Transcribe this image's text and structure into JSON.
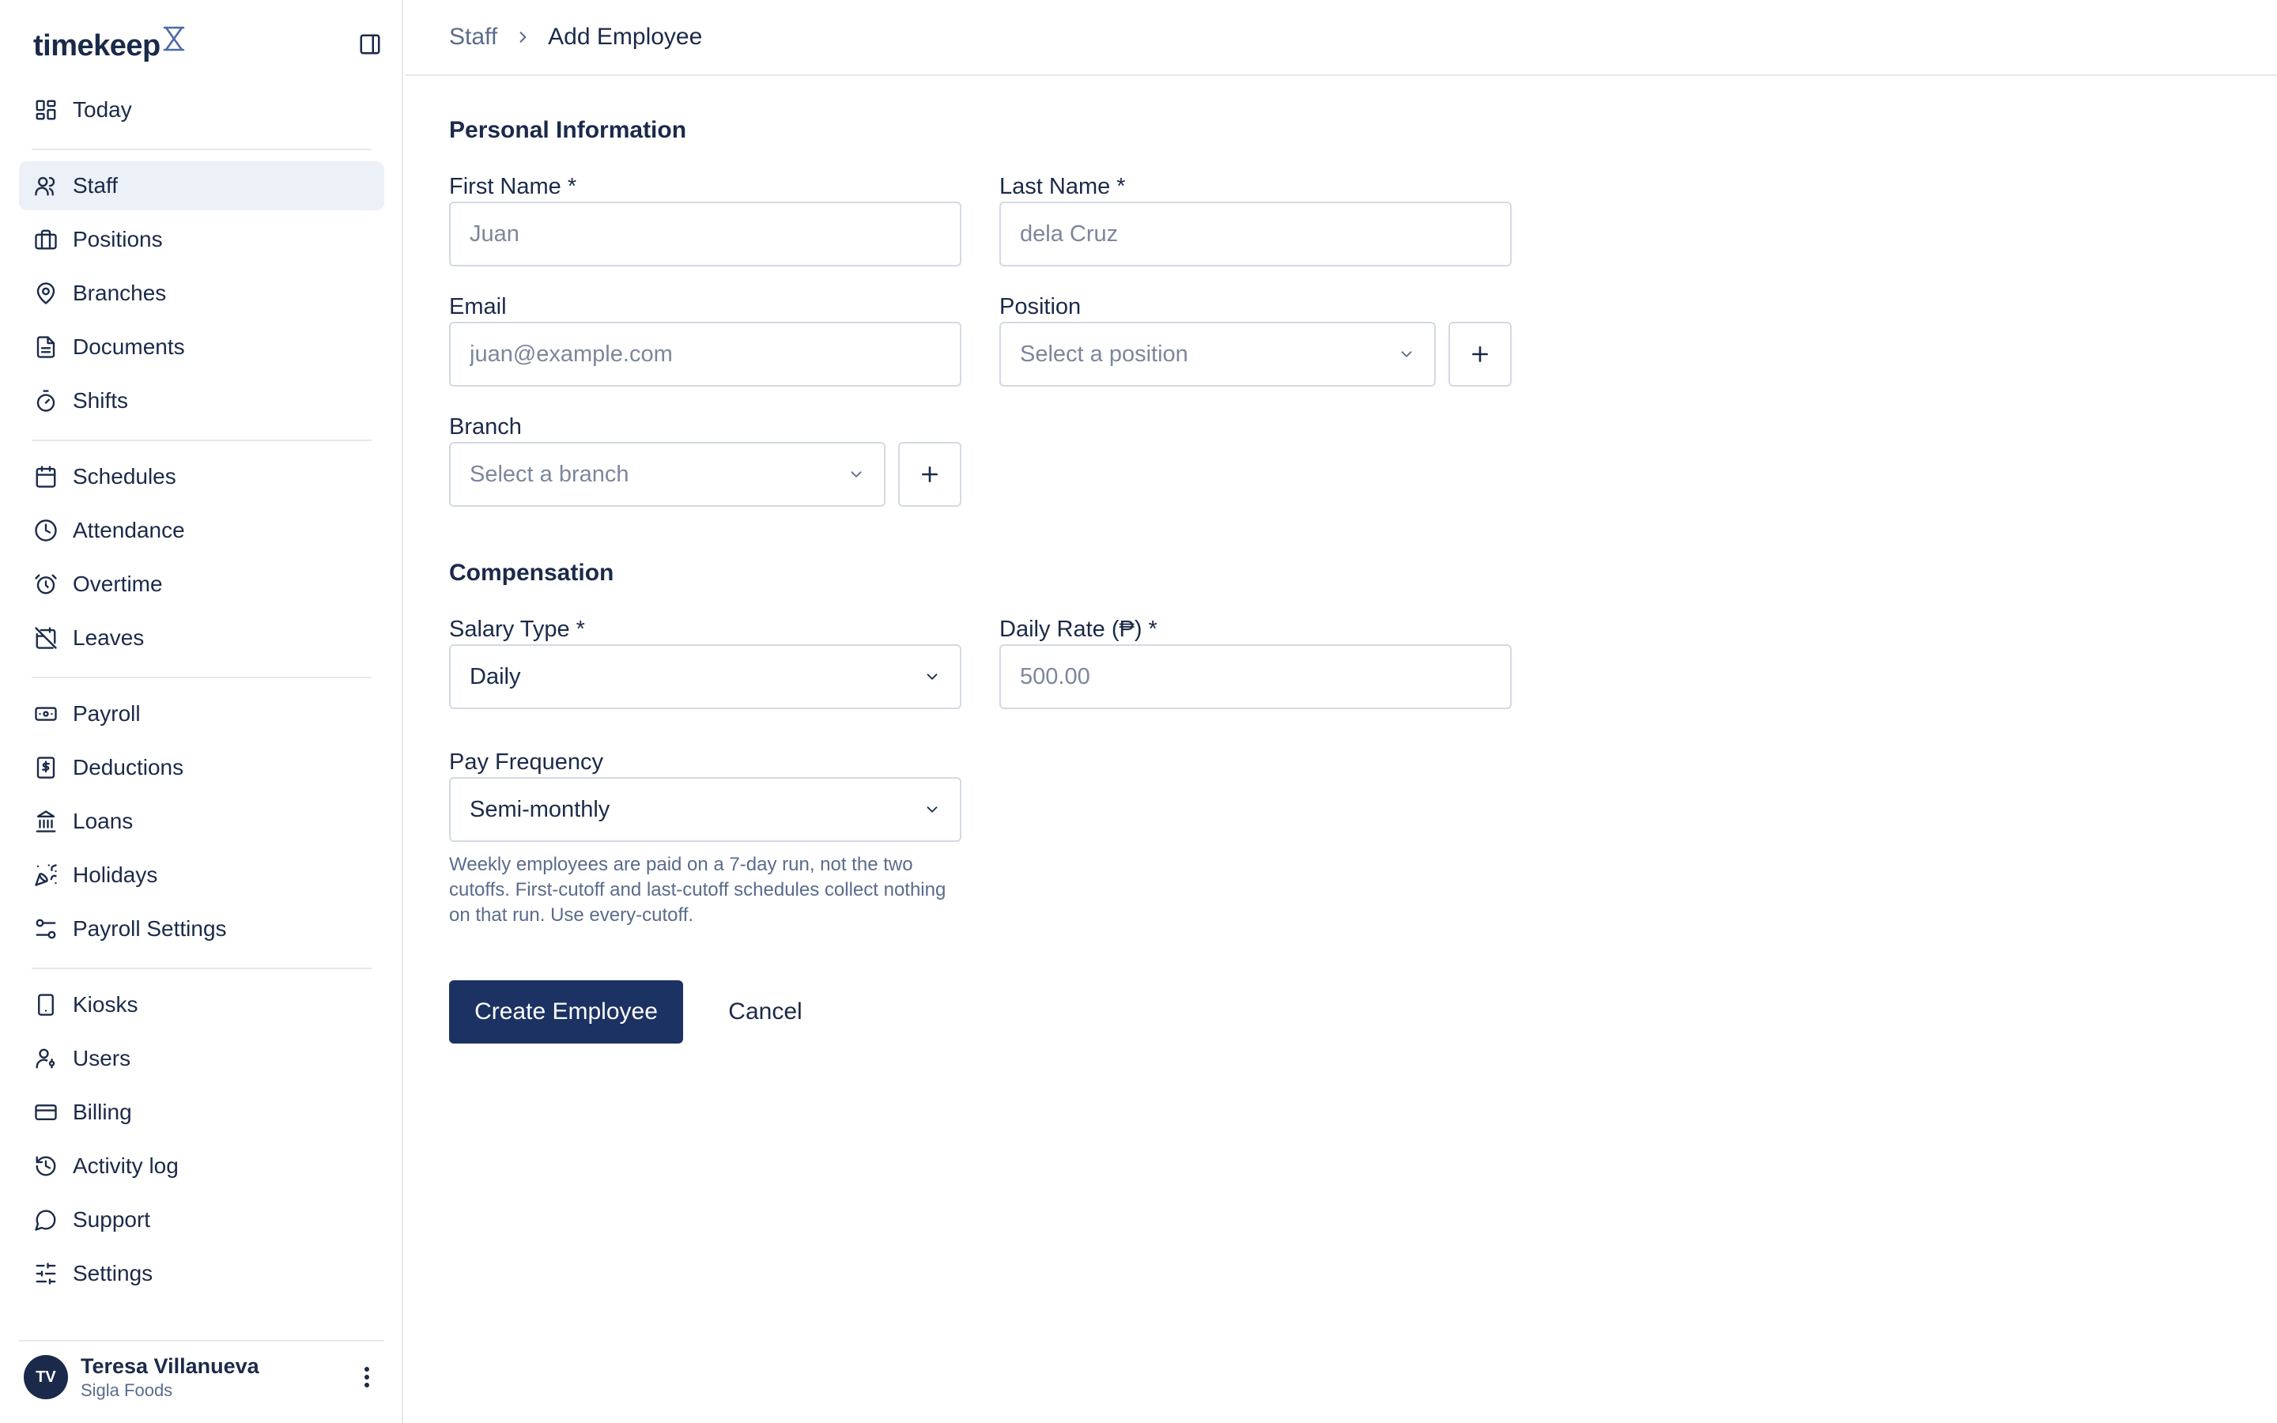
{
  "app": {
    "brand": "timekeep"
  },
  "sidebar": {
    "groups": [
      [
        {
          "label": "Today",
          "icon": "dashboard-icon"
        }
      ],
      [
        {
          "label": "Staff",
          "icon": "users-icon",
          "active": true
        },
        {
          "label": "Positions",
          "icon": "briefcase-icon"
        },
        {
          "label": "Branches",
          "icon": "map-pin-icon"
        },
        {
          "label": "Documents",
          "icon": "document-icon"
        },
        {
          "label": "Shifts",
          "icon": "stopwatch-icon"
        }
      ],
      [
        {
          "label": "Schedules",
          "icon": "calendar-icon"
        },
        {
          "label": "Attendance",
          "icon": "clock-icon"
        },
        {
          "label": "Overtime",
          "icon": "alarm-clock-icon"
        },
        {
          "label": "Leaves",
          "icon": "calendar-off-icon"
        }
      ],
      [
        {
          "label": "Payroll",
          "icon": "banknote-icon"
        },
        {
          "label": "Deductions",
          "icon": "receipt-icon"
        },
        {
          "label": "Loans",
          "icon": "bank-icon"
        },
        {
          "label": "Holidays",
          "icon": "party-popper-icon"
        },
        {
          "label": "Payroll Settings",
          "icon": "sliders-icon"
        }
      ],
      [
        {
          "label": "Kiosks",
          "icon": "tablet-icon"
        },
        {
          "label": "Users",
          "icon": "user-key-icon"
        },
        {
          "label": "Billing",
          "icon": "credit-card-icon"
        },
        {
          "label": "Activity log",
          "icon": "history-icon"
        },
        {
          "label": "Support",
          "icon": "chat-bubble-icon"
        },
        {
          "label": "Settings",
          "icon": "settings-sliders-icon"
        }
      ]
    ],
    "user": {
      "initials": "TV",
      "name": "Teresa Villanueva",
      "org": "Sigla Foods"
    }
  },
  "breadcrumb": {
    "parent": "Staff",
    "current": "Add Employee"
  },
  "form": {
    "personal_title": "Personal Information",
    "first_name": {
      "label": "First Name *",
      "placeholder": "Juan"
    },
    "last_name": {
      "label": "Last Name *",
      "placeholder": "dela Cruz"
    },
    "email": {
      "label": "Email",
      "placeholder": "juan@example.com"
    },
    "position": {
      "label": "Position",
      "placeholder": "Select a position"
    },
    "branch": {
      "label": "Branch",
      "placeholder": "Select a branch"
    },
    "compensation_title": "Compensation",
    "salary_type": {
      "label": "Salary Type *",
      "value": "Daily"
    },
    "daily_rate": {
      "label": "Daily Rate (₱) *",
      "placeholder": "500.00"
    },
    "pay_frequency": {
      "label": "Pay Frequency",
      "value": "Semi-monthly"
    },
    "helper": "Weekly employees are paid on a 7-day run, not the two cutoffs. First-cutoff and last-cutoff schedules collect nothing on that run. Use every-cutoff.",
    "submit_label": "Create Employee",
    "cancel_label": "Cancel"
  },
  "colors": {
    "primary": "#1b3263",
    "text": "#1b2a4a",
    "muted": "#5a6b8c",
    "active_bg": "#ecf0f7",
    "border": "#d4d9e3"
  }
}
